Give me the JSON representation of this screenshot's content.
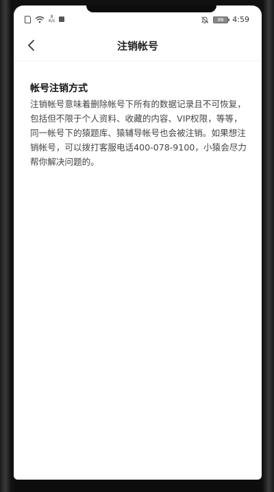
{
  "status_bar": {
    "speed_value": "8",
    "speed_unit": "K/s",
    "battery": "86",
    "time": "4:59"
  },
  "nav": {
    "title": "注销帐号"
  },
  "content": {
    "heading": "帐号注销方式",
    "body": "注销帐号意味着删除帐号下所有的数据记录且不可恢复，包括但不限于个人资料、收藏的内容、VIP权限，等等，同一帐号下的猿题库、猿辅导帐号也会被注销。如果想注销帐号，可以拨打客服电话400-078-9100，小猿会尽力帮你解决问题的。"
  },
  "icons": {
    "sim": "sim-card-icon",
    "wifi": "wifi-icon",
    "notification": "notification-square-icon",
    "mute": "bell-off-icon",
    "battery": "battery-icon",
    "back": "chevron-left-icon"
  }
}
